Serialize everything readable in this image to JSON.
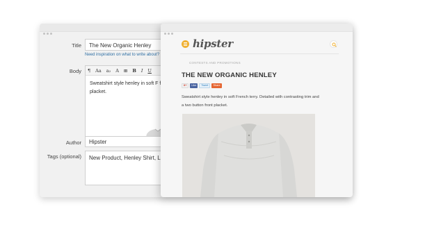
{
  "editor": {
    "title_label": "Title",
    "title_value": "The New Organic Henley",
    "help_link": "Need inspiration on what to write about? G",
    "body_label": "Body",
    "toolbar": [
      "¶",
      "Aa",
      "a₂",
      "A",
      "⊞",
      "B",
      "I",
      "U"
    ],
    "body_text": "Sweatshirt style henley in soft F front placket.",
    "author_label": "Author",
    "author_value": "Hipster",
    "tags_label": "Tags (optional)",
    "tags_value": "New Product, Henley Shirt, Lor"
  },
  "preview": {
    "logo": "hipster",
    "category": "CONTESTS AND PROMOTIONS",
    "post_title": "THE NEW ORGANIC HENLEY",
    "share": {
      "gplus": "8+",
      "like": "Like",
      "tweet": "Tweet",
      "share": "Share"
    },
    "body_line1": "Sweatshirt style henley in soft French terry. Detailed with contrasting trim and",
    "body_line2": "a two button front placket."
  },
  "colors": {
    "accent": "#f0b032",
    "link": "#2d6ea3",
    "window": "#f1f1f1"
  },
  "icons": {
    "menu": "hamburger-icon",
    "search": "search-icon"
  }
}
